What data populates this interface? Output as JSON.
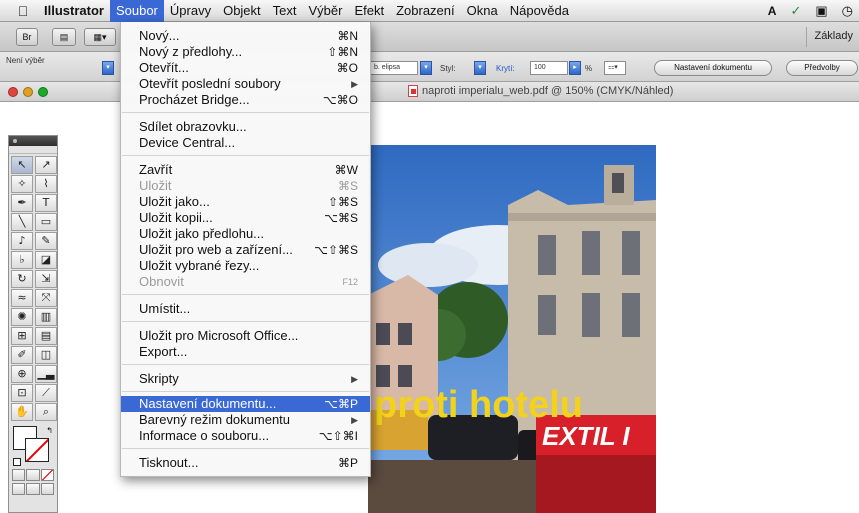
{
  "menubar": {
    "apple_icon": "apple-icon",
    "app_name": "Illustrator",
    "items": [
      "Soubor",
      "Úpravy",
      "Objekt",
      "Text",
      "Výběr",
      "Efekt",
      "Zobrazení",
      "Okna",
      "Nápověda"
    ],
    "active_item": "Soubor",
    "status_icons": [
      "adobe-ai-icon",
      "swirl-icon",
      "display-icon",
      "time-machine-icon"
    ]
  },
  "app_bar": {
    "workspace_label": "Základy"
  },
  "control_bar": {
    "selection_label": "Není výběr",
    "shape_value": "b. elipsa",
    "style_label": "Styl:",
    "opacity_label": "Krytí:",
    "opacity_value": "100",
    "percent_sign": "%",
    "doc_setup_button": "Nastavení dokumentu",
    "prefs_button": "Předvolby"
  },
  "document": {
    "title": "naproti imperialu_web.pdf @ 150% (CMYK/Náhled)",
    "overlay_text": "proti hotelu",
    "sign_text": "EXTIL I"
  },
  "file_menu": {
    "items": [
      {
        "label": "Nový...",
        "shortcut": "⌘N"
      },
      {
        "label": "Nový z předlohy...",
        "shortcut": "⇧⌘N"
      },
      {
        "label": "Otevřít...",
        "shortcut": "⌘O"
      },
      {
        "label": "Otevřít poslední soubory",
        "shortcut": "▶"
      },
      {
        "label": "Procházet Bridge...",
        "shortcut": "⌥⌘O"
      },
      {
        "label": "Sdílet obrazovku...",
        "shortcut": ""
      },
      {
        "label": "Device Central...",
        "shortcut": ""
      },
      {
        "label": "Zavřít",
        "shortcut": "⌘W"
      },
      {
        "label": "Uložit",
        "shortcut": "⌘S"
      },
      {
        "label": "Uložit jako...",
        "shortcut": "⇧⌘S"
      },
      {
        "label": "Uložit kopii...",
        "shortcut": "⌥⌘S"
      },
      {
        "label": "Uložit jako předlohu...",
        "shortcut": ""
      },
      {
        "label": "Uložit pro web a zařízení...",
        "shortcut": "⌥⇧⌘S"
      },
      {
        "label": "Uložit vybrané řezy...",
        "shortcut": ""
      },
      {
        "label": "Obnovit",
        "shortcut": "F12"
      },
      {
        "label": "Umístit...",
        "shortcut": ""
      },
      {
        "label": "Uložit pro Microsoft Office...",
        "shortcut": ""
      },
      {
        "label": "Export...",
        "shortcut": ""
      },
      {
        "label": "Skripty",
        "shortcut": "▶"
      },
      {
        "label": "Nastavení dokumentu...",
        "shortcut": "⌥⌘P"
      },
      {
        "label": "Barevný režim dokumentu",
        "shortcut": "▶"
      },
      {
        "label": "Informace o souboru...",
        "shortcut": "⌥⇧⌘I"
      },
      {
        "label": "Tisknout...",
        "shortcut": "⌘P"
      }
    ],
    "disabled_items": [
      "Uložit",
      "Obnovit"
    ],
    "highlighted_item": "Nastavení dokumentu..."
  },
  "colors": {
    "menu_highlight": "#3a68d4",
    "overlay_text_yellow": "#f2d21a",
    "sign_red": "#d8202a"
  }
}
